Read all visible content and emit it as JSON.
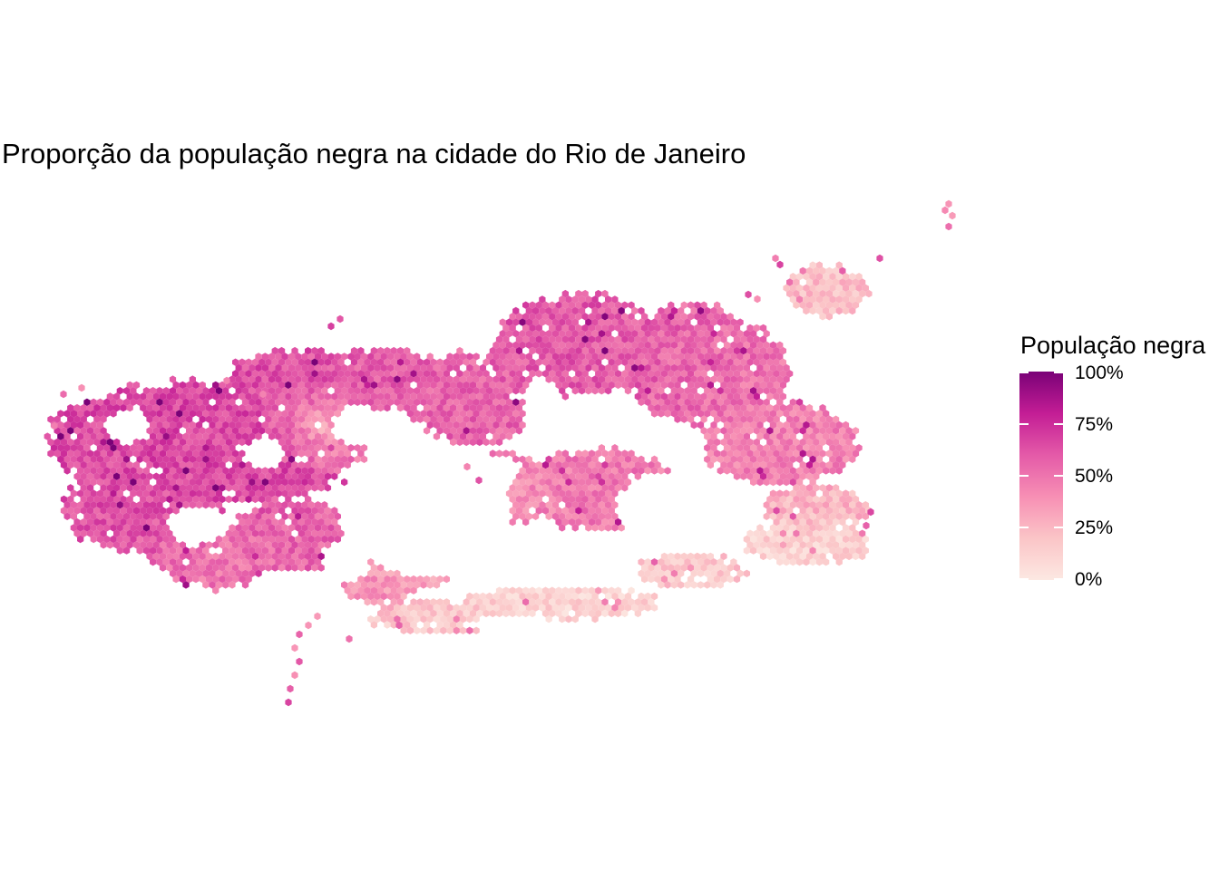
{
  "title": "Proporção da população negra na cidade do Rio de Janeiro",
  "legend": {
    "title": "População negra",
    "ticks": [
      "100%",
      "75%",
      "50%",
      "25%",
      "0%"
    ],
    "tick_values": [
      1.0,
      0.75,
      0.5,
      0.25,
      0.0
    ]
  },
  "colors": {
    "scale": [
      "#fce8e2",
      "#fbc5c7",
      "#f78fb4",
      "#e45aa8",
      "#c31d95",
      "#7a0177"
    ],
    "background": "#ffffff"
  },
  "chart_data": {
    "type": "heatmap",
    "title": "Proporção da população negra na cidade do Rio de Janeiro",
    "legend_title": "População negra",
    "value_range": [
      0,
      1
    ],
    "legend_placement": "right",
    "grid": false
  }
}
